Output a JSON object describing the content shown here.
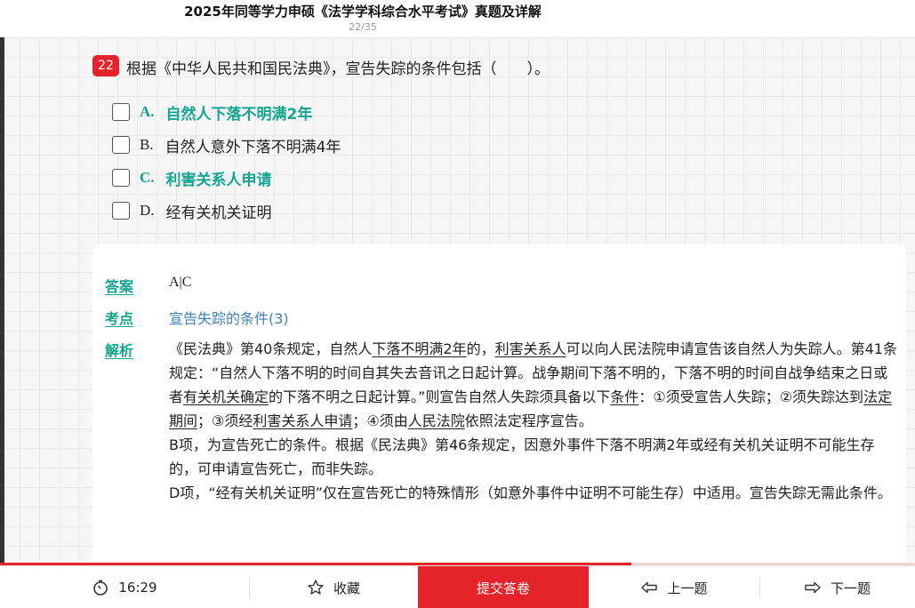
{
  "header": {
    "title": "2025年同等学力申硕《法学学科综合水平考试》真题及详解",
    "page_counter": "22/35"
  },
  "question": {
    "number": "22",
    "text": "根据《中华人民共和国民法典》，宣告失踪的条件包括（　　）。",
    "options": [
      {
        "letter": "A.",
        "text": "自然人下落不明满2年",
        "correct": true
      },
      {
        "letter": "B.",
        "text": "自然人意外下落不明满4年",
        "correct": false
      },
      {
        "letter": "C.",
        "text": "利害关系人申请",
        "correct": true
      },
      {
        "letter": "D.",
        "text": "经有关机关证明",
        "correct": false
      }
    ]
  },
  "answer_card": {
    "answer_label": "答案",
    "answer_value": "A|C",
    "keypoint_label": "考点",
    "keypoint_value": "宣告失踪的条件(3)",
    "explain_label": "解析",
    "para1": {
      "s1": "《民法典》第40条规定，自然人",
      "u1": "下落不明满2年",
      "s2": "的，",
      "u2": "利害关系人",
      "s3": "可以向人民法院申请宣告该自然人为失踪人。第41条规定：“自然人下落不明的时间自其失去音讯之日起计算。战争期间下落不明的，下落不明的时间自战争结束之日或者",
      "u3": "有关机关确定",
      "s4": "的下落不明之日起计算。”则宣告自然人失踪须具备以下",
      "u4": "条件",
      "s5": "：①须受宣告人失踪；②须失踪达到",
      "u5": "法定期间",
      "s6": "；③须经",
      "u6": "利害关系人申请",
      "s7": "；④须由",
      "u7": "人民法院",
      "s8": "依照法定程序宣告。"
    },
    "para2": "B项，为宣告死亡的条件。根据《民法典》第46条规定，因意外事件下落不明满2年或经有关机关证明不可能生存的，可申请宣告死亡，而非失踪。",
    "para3": "D项，“经有关机关证明”仅在宣告死亡的特殊情形（如意外事件中证明不可能生存）中适用。宣告失踪无需此条件。"
  },
  "progress": {
    "fraction": 0.69
  },
  "bottom_bar": {
    "timer": "16:29",
    "favorite": "收藏",
    "submit": "提交答卷",
    "prev": "上一题",
    "next": "下一题",
    "icons": [
      "stopwatch-icon",
      "star-icon",
      "arrow-left-icon",
      "arrow-right-icon"
    ]
  },
  "colors": {
    "accent_red": "#e5232a",
    "correct_green": "#13a590",
    "link_blue": "#3d7fb8"
  }
}
